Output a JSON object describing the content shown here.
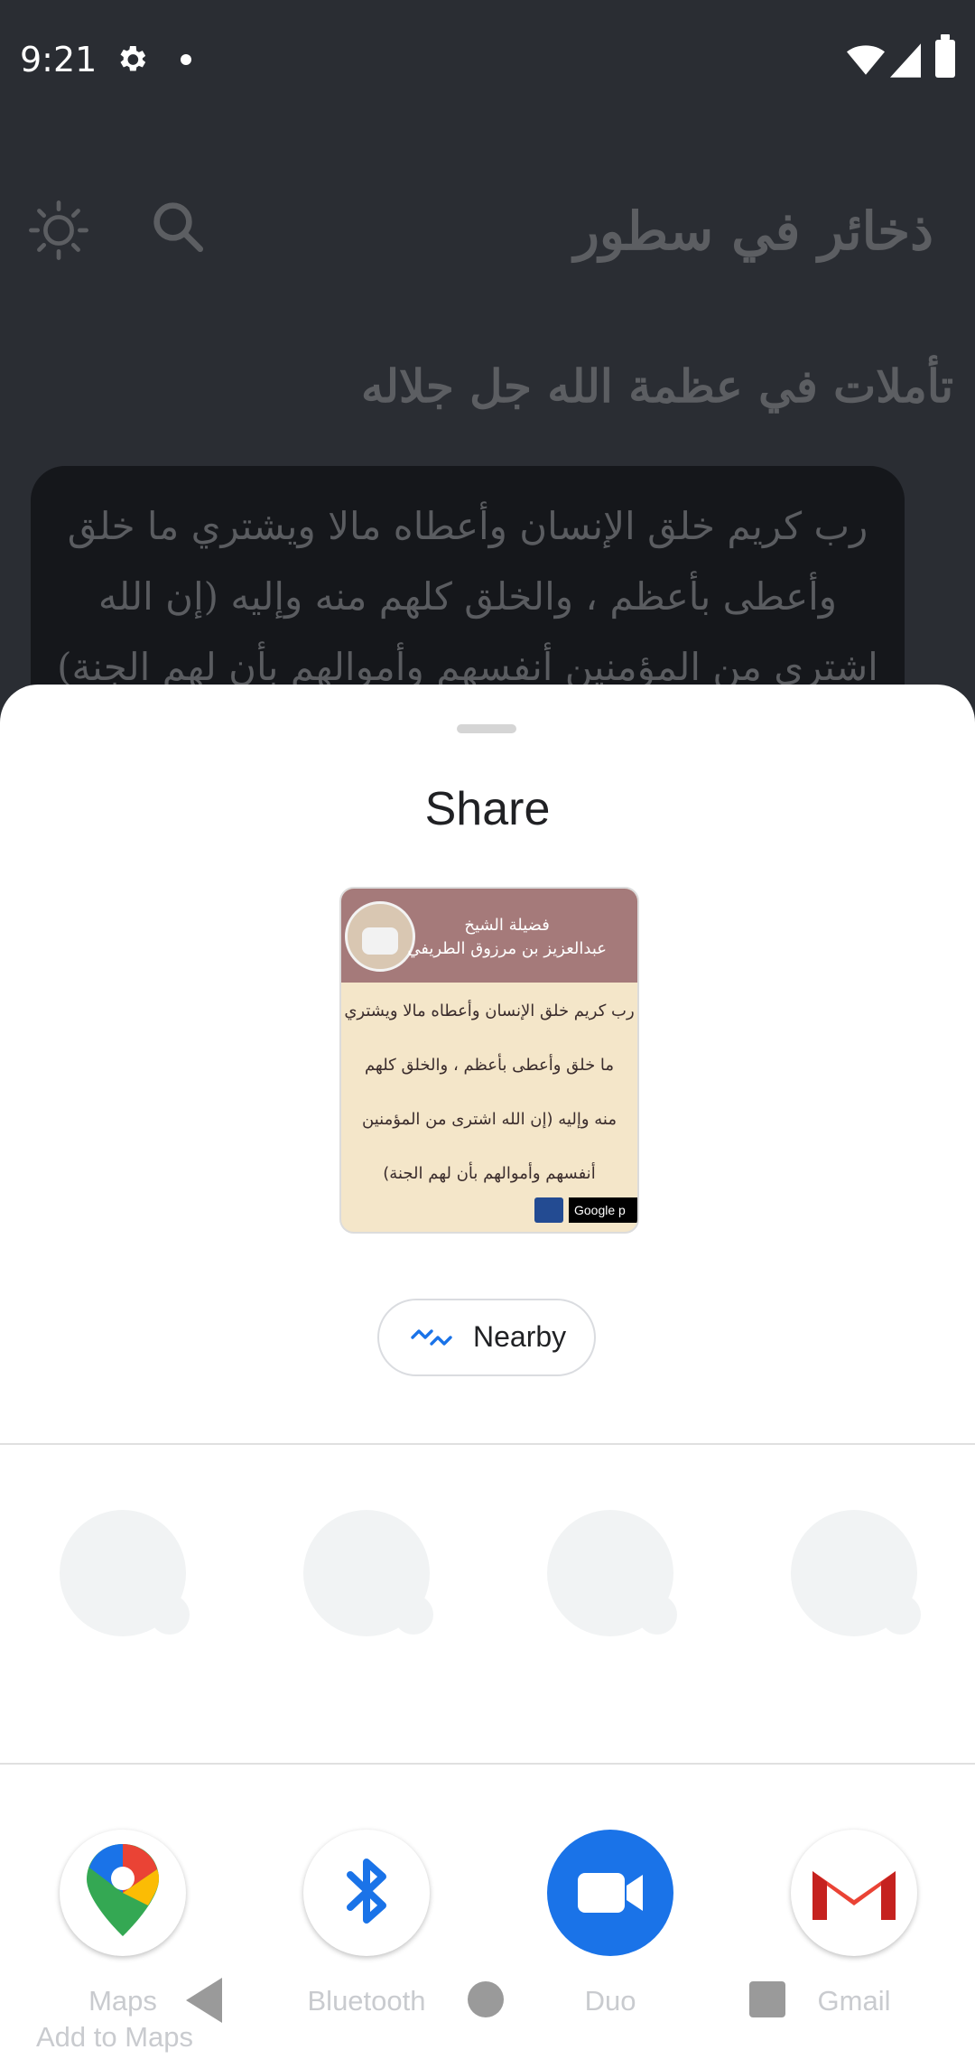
{
  "status_bar": {
    "time": "9:21"
  },
  "app": {
    "title": "ذخائر في سطور",
    "section_title": "تأملات في عظمة الله جل جلاله",
    "quote": "رب كريم خلق الإنسان وأعطاه مالا ويشتري ما خلق وأعطى بأعظم ، والخلق كلهم منه وإليه (إن الله اشترى من المؤمنين أنفسهم وأموالهم بأن لهم الجنة)"
  },
  "share_sheet": {
    "title": "Share",
    "preview": {
      "header_line1": "فضيلة الشيخ",
      "header_line2": "عبدالعزيز بن مرزوق الطريفي",
      "lines": [
        "رب كريم خلق الإنسان وأعطاه مالا ويشتري",
        "ما خلق وأعطى بأعظم ، والخلق كلهم",
        "منه وإليه (إن الله اشترى من المؤمنين",
        "أنفسهم وأموالهم بأن لهم الجنة)"
      ],
      "badge_text": "Google p"
    },
    "nearby_label": "Nearby",
    "apps": [
      {
        "label": "Maps",
        "icon": "google-maps-icon"
      },
      {
        "label": "Bluetooth",
        "icon": "bluetooth-icon"
      },
      {
        "label": "Duo",
        "icon": "duo-video-icon"
      },
      {
        "label": "Gmail",
        "icon": "gmail-icon"
      }
    ],
    "maps_sublabel": "Add to Maps"
  },
  "colors": {
    "accent": "#1a73e8",
    "sheet_bg": "#ffffff",
    "scrim": "#2a2d33"
  }
}
